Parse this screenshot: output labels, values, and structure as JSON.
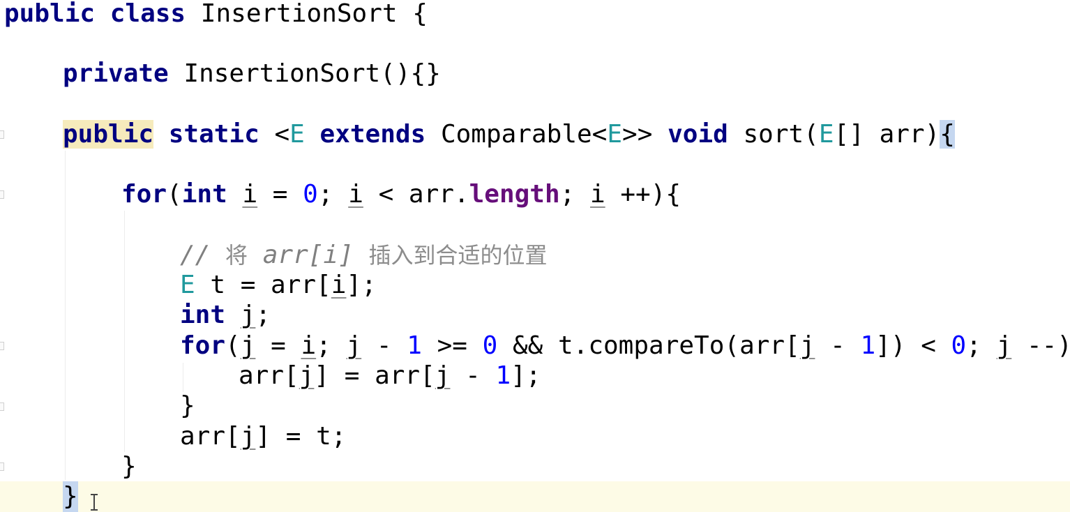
{
  "editor": {
    "language": "Java",
    "class_name": "InsertionSort",
    "comment_text": "// 将 arr[i] 插入到合适的位置",
    "tokens": {
      "public": "public",
      "class": "class",
      "private": "private",
      "static": "static",
      "extends": "extends",
      "void": "void",
      "int": "int",
      "for": "for",
      "class_name": "InsertionSort",
      "ctor_sig": "(){}",
      "open_brace_sp": " {",
      "type_param_open": "<",
      "type_param": "E",
      "comparable_open": "Comparable<",
      "close_angles": ">>",
      "sort_open": "sort(",
      "array_param_rest": "[] arr)",
      "open_brace": "{",
      "close_brace": "}",
      "for_open": "(",
      "i": "i",
      "j": "j",
      "assign_zero": " = ",
      "zero": "0",
      "one": "1",
      "semi_sp": "; ",
      "lt_arr": " < arr.",
      "length": "length",
      "inc_close": " ++){",
      "dec_close": " --){",
      "t_assign_arr": " t = arr[",
      "close_bracket_semi": "];",
      "j_semi": ";",
      "j_assign": " = ",
      "minus": " - ",
      "ge": " >= ",
      "and_compare": " && t.compareTo(arr[",
      "close_paren_lt": "]) < ",
      "arr_open": "arr[",
      "close_assign_arr_open": "] = arr[",
      "close_assign_t": "] = t;"
    }
  },
  "icons": {
    "caret": "text-cursor-icon",
    "fold": "fold-marker-icon"
  },
  "colors": {
    "keyword": "#000080",
    "number": "#0000ff",
    "type_param": "#20999d",
    "field": "#660e7a",
    "comment": "#808080",
    "current_line": "#fdfbe6",
    "brace_match": "#c5d7f0",
    "keyword_highlight": "#f6ebbc"
  }
}
